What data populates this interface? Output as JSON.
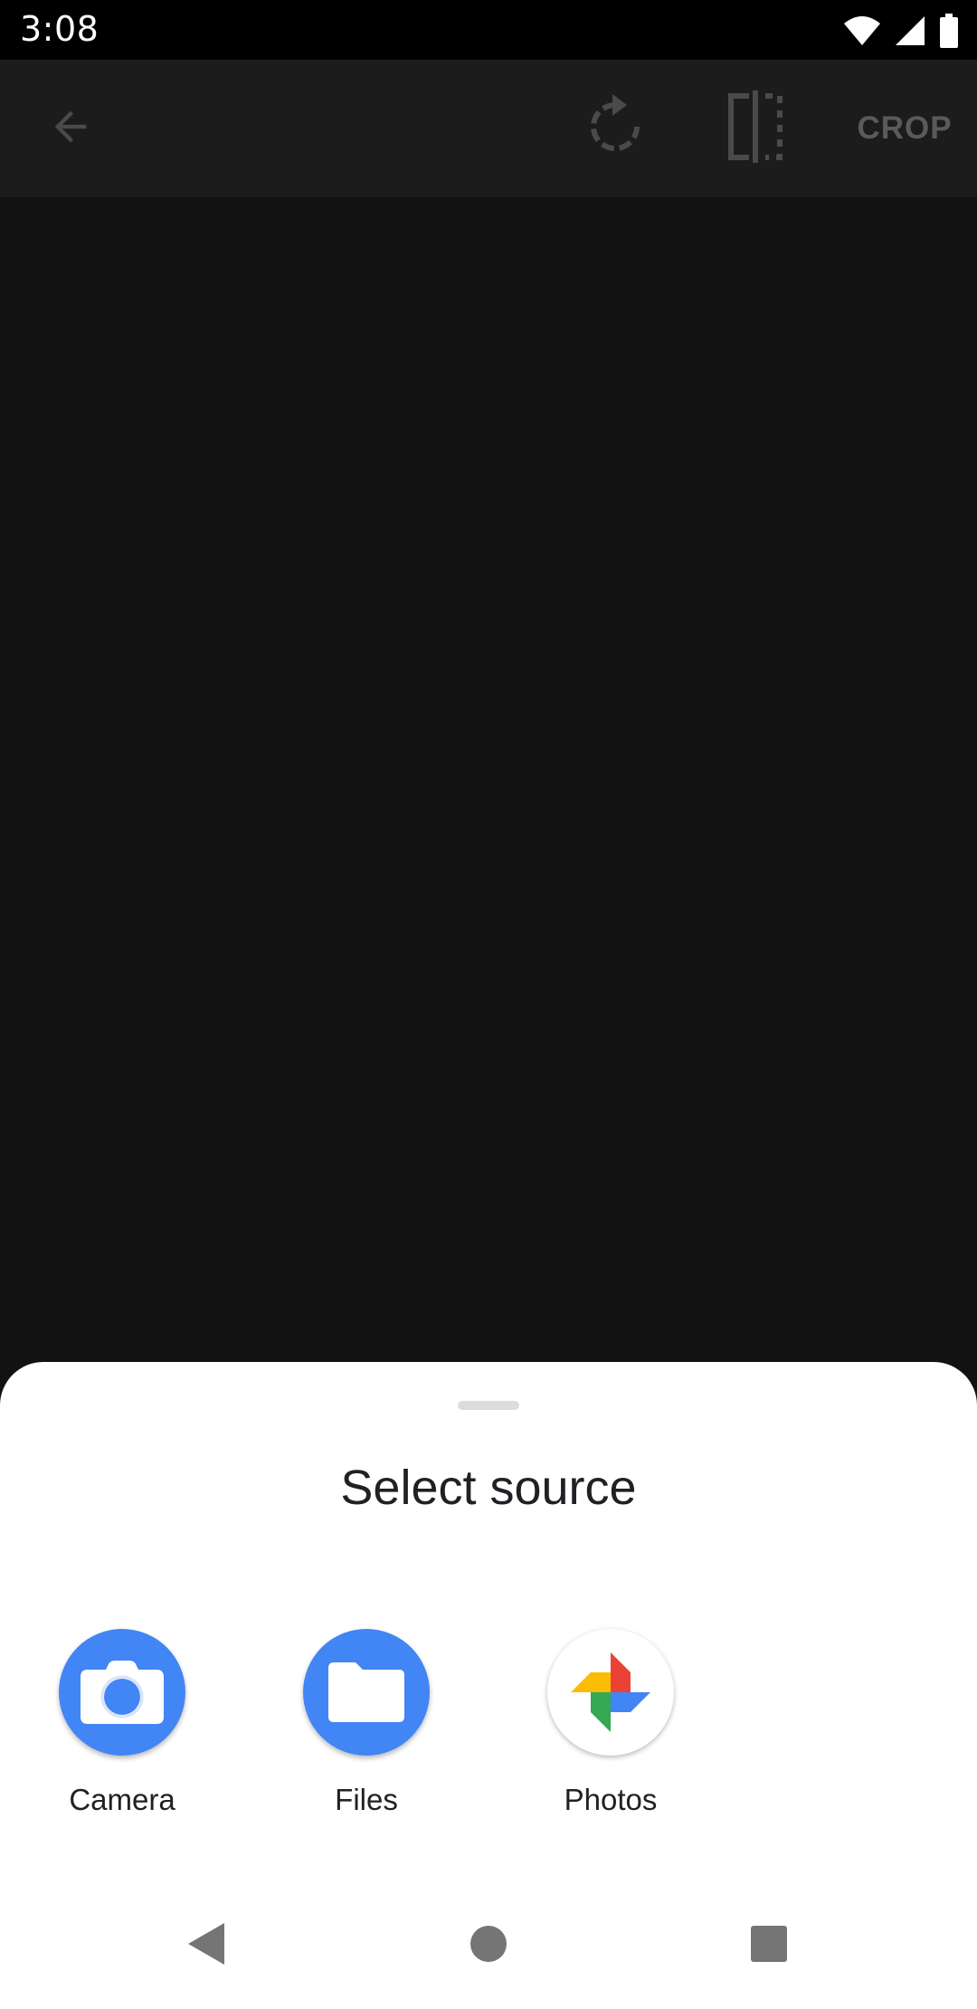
{
  "status_bar": {
    "time": "3:08",
    "icons": [
      "wifi-icon",
      "signal-icon",
      "battery-icon"
    ]
  },
  "app_bar": {
    "back_icon": "arrow-back-icon",
    "rotate_icon": "rotate-icon",
    "flip_icon": "flip-icon",
    "crop_label": "CROP"
  },
  "sheet": {
    "title": "Select source",
    "sources": [
      {
        "label": "Camera",
        "icon": "camera-icon",
        "color": "#4285f4"
      },
      {
        "label": "Files",
        "icon": "folder-icon",
        "color": "#4285f4"
      },
      {
        "label": "Photos",
        "icon": "photos-pinwheel-icon"
      }
    ]
  },
  "nav_bar": {
    "back_icon": "nav-back-icon",
    "home_icon": "nav-home-icon",
    "recents_icon": "nav-recents-icon"
  },
  "colors": {
    "scrim_background": "#121212",
    "sheet_background": "#ffffff",
    "accent_blue": "#4285f4"
  }
}
